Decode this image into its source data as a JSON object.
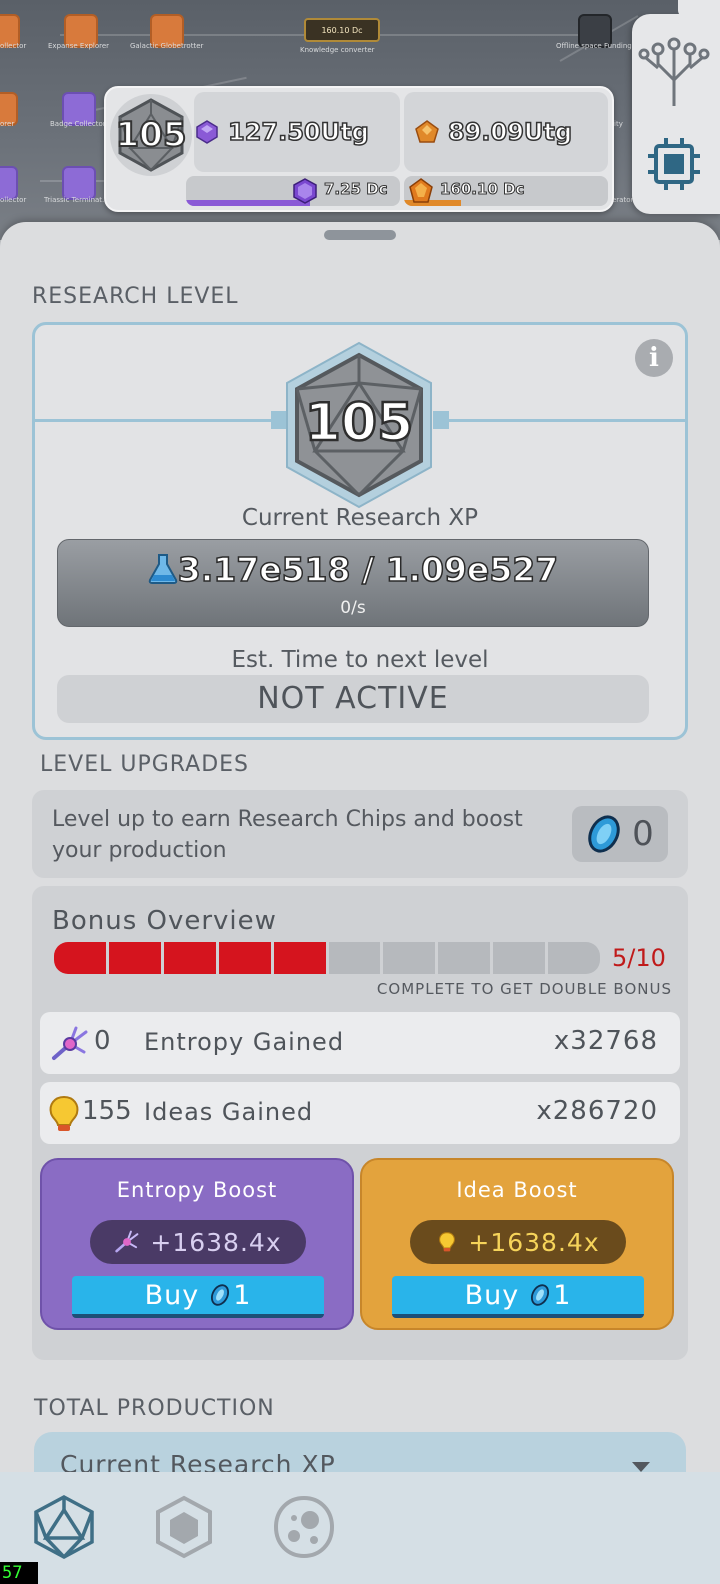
{
  "tech_tree": {
    "nodes": [
      {
        "label": "ollector"
      },
      {
        "label": "Expanse Explorer"
      },
      {
        "label": "Galactic Globetrotter"
      },
      {
        "label": "Knowledge converter"
      },
      {
        "label": "Offline space Funding"
      },
      {
        "label": "orer"
      },
      {
        "label": "Badge Collector"
      },
      {
        "label": "ollector"
      },
      {
        "label": "Triassic Terminat..."
      },
      {
        "label": "ity"
      },
      {
        "label": "erator"
      }
    ],
    "converter_badge": "160.10 Dc"
  },
  "hud": {
    "level": "105",
    "primary_left": "127.50Utg",
    "primary_right": "89.09Utg",
    "secondary_left": "7.25 Dc",
    "secondary_right": "160.10 Dc",
    "secondary_left_progress": 0.58,
    "secondary_right_progress": 0.28,
    "colors": {
      "purple": "#8a5ad6",
      "orange": "#e0892a"
    }
  },
  "side_tab": {
    "icons": [
      "tech-tree-icon",
      "chip-icon"
    ]
  },
  "research_level": {
    "section_title": "RESEARCH LEVEL",
    "level": "105",
    "xp_label": "Current Research XP",
    "xp_value": "3.17e518 / 1.09e527",
    "xp_rate": "0/s",
    "est_label": "Est. Time to next level",
    "est_value": "NOT ACTIVE"
  },
  "level_upgrades": {
    "section_title": "LEVEL UPGRADES",
    "description": "Level up to earn Research Chips and boost your production",
    "chips": "0"
  },
  "bonus": {
    "title": "Bonus Overview",
    "progress_current": 5,
    "progress_total": 10,
    "progress_label": "5/10",
    "hint": "COMPLETE TO GET DOUBLE BONUS",
    "rows": [
      {
        "count": "0",
        "label": "Entropy Gained",
        "multiplier": "x32768"
      },
      {
        "count": "155",
        "label": "Ideas Gained",
        "multiplier": "x286720"
      }
    ],
    "boosts": [
      {
        "title": "Entropy Boost",
        "value": "+1638.4x",
        "buy_label": "Buy",
        "cost": "1"
      },
      {
        "title": "Idea Boost",
        "value": "+1638.4x",
        "buy_label": "Buy",
        "cost": "1"
      }
    ]
  },
  "total_production": {
    "section_title": "TOTAL PRODUCTION",
    "dropdown_value": "Current Research XP"
  },
  "bottom_nav": {
    "items": [
      "research-level-tab",
      "upgrades-tab",
      "lab-tab"
    ]
  },
  "fps_counter": "57"
}
